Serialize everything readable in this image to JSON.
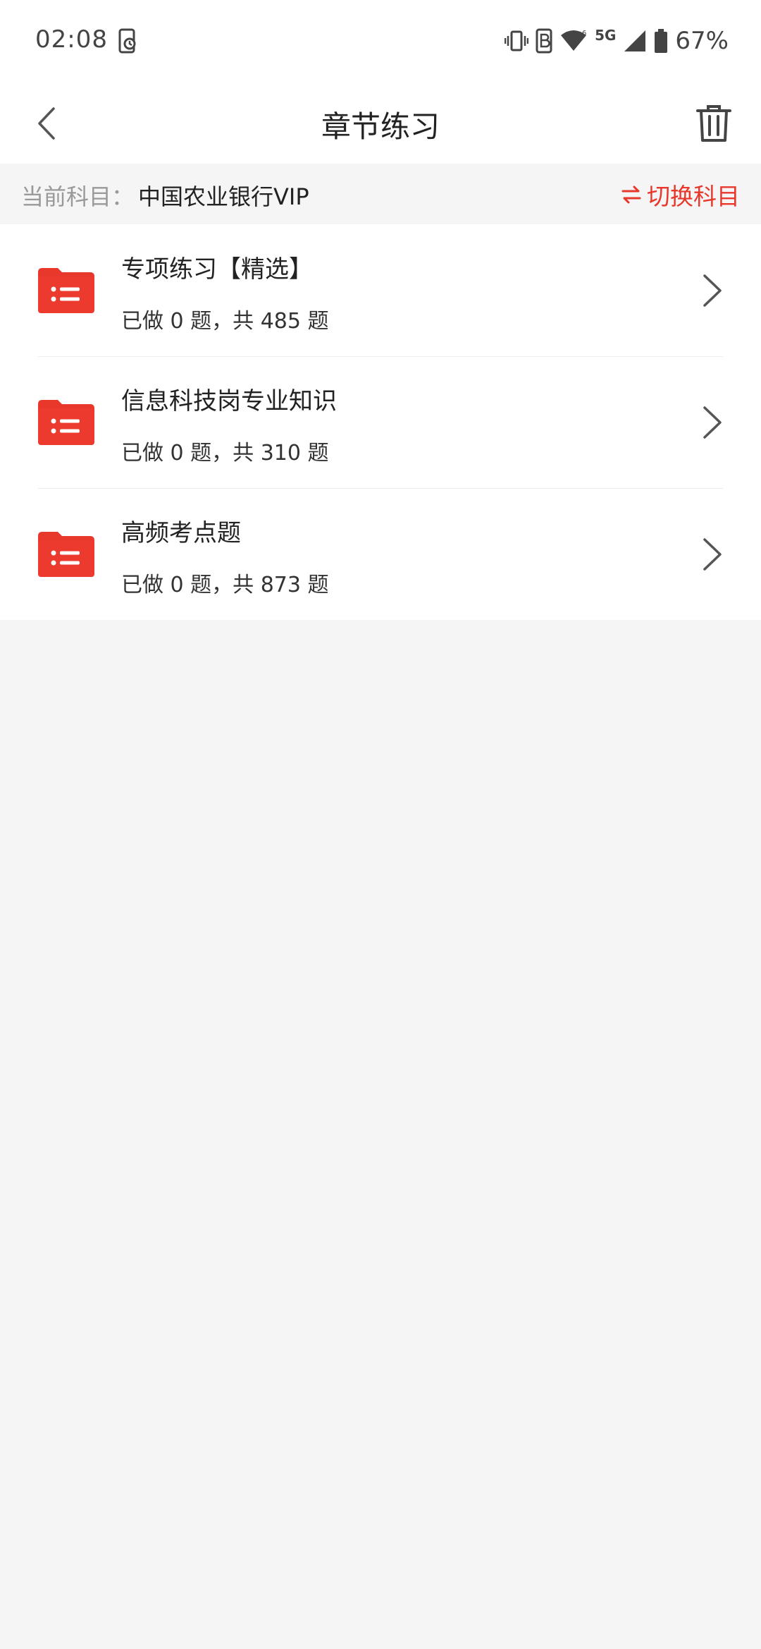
{
  "status_bar": {
    "time": "02:08",
    "network": "5G",
    "battery": "67%"
  },
  "header": {
    "title": "章节练习"
  },
  "subject": {
    "label": "当前科目：",
    "value": "中国农业银行VIP",
    "switch_label": "切换科目"
  },
  "chapters": [
    {
      "title": "专项练习【精选】",
      "progress": "已做 0 题，共 485 题"
    },
    {
      "title": "信息科技岗专业知识",
      "progress": "已做 0 题，共 310 题"
    },
    {
      "title": "高频考点题",
      "progress": "已做 0 题，共 873 题"
    }
  ],
  "colors": {
    "accent": "#e8382c",
    "background": "#f5f5f5",
    "surface": "#ffffff"
  },
  "icons": {
    "back": "chevron-left-icon",
    "trash": "trash-icon",
    "switch": "swap-arrows-icon",
    "folder": "folder-list-icon",
    "item_arrow": "chevron-right-icon"
  }
}
